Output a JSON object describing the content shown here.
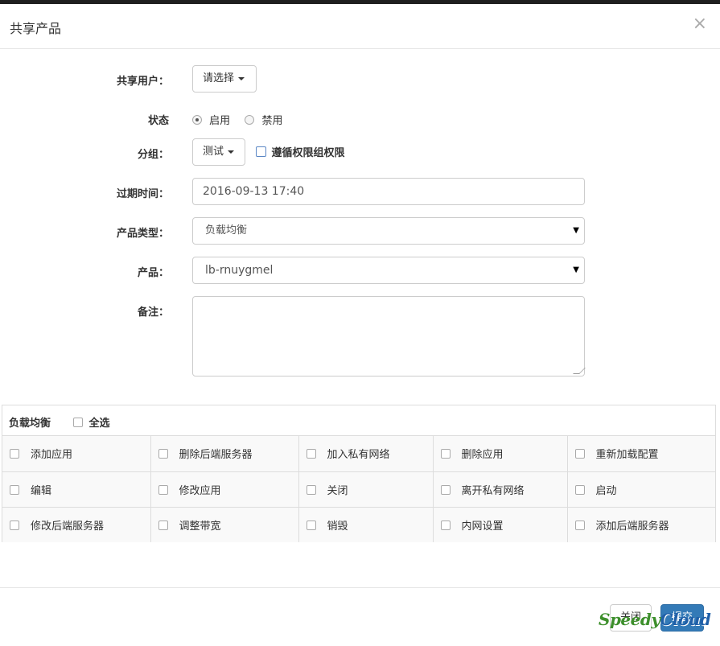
{
  "modal": {
    "title": "共享产品",
    "close_symbol": "×"
  },
  "form": {
    "share_user": {
      "label": "共享用户：",
      "value": "请选择"
    },
    "status": {
      "label": "状态",
      "options": [
        {
          "label": "启用",
          "checked": true
        },
        {
          "label": "禁用",
          "checked": false
        }
      ]
    },
    "group": {
      "label": "分组：",
      "value": "测试",
      "follow_label": "遵循权限组权限"
    },
    "expire": {
      "label": "过期时间：",
      "value": "2016-09-13 17:40"
    },
    "product_type": {
      "label": "产品类型：",
      "value": "负载均衡"
    },
    "product": {
      "label": "产品：",
      "value": "lb-rnuygmel"
    },
    "remark": {
      "label": "备注：",
      "value": ""
    }
  },
  "permissions": {
    "title": "负载均衡",
    "select_all": "全选",
    "rows": [
      [
        "添加应用",
        "删除后端服务器",
        "加入私有网络",
        "删除应用",
        "重新加载配置"
      ],
      [
        "编辑",
        "修改应用",
        "关闭",
        "离开私有网络",
        "启动"
      ],
      [
        "修改后端服务器",
        "调整带宽",
        "销毁",
        "内网设置",
        "添加后端服务器"
      ]
    ]
  },
  "footer": {
    "close_label": "关闭",
    "submit_label": "提交"
  },
  "watermark": {
    "part1": "Speedy",
    "part2": "Cloud"
  },
  "colors": {
    "primary": "#337ab7",
    "border": "#cccccc",
    "watermark_green": "#3d8f2c"
  }
}
